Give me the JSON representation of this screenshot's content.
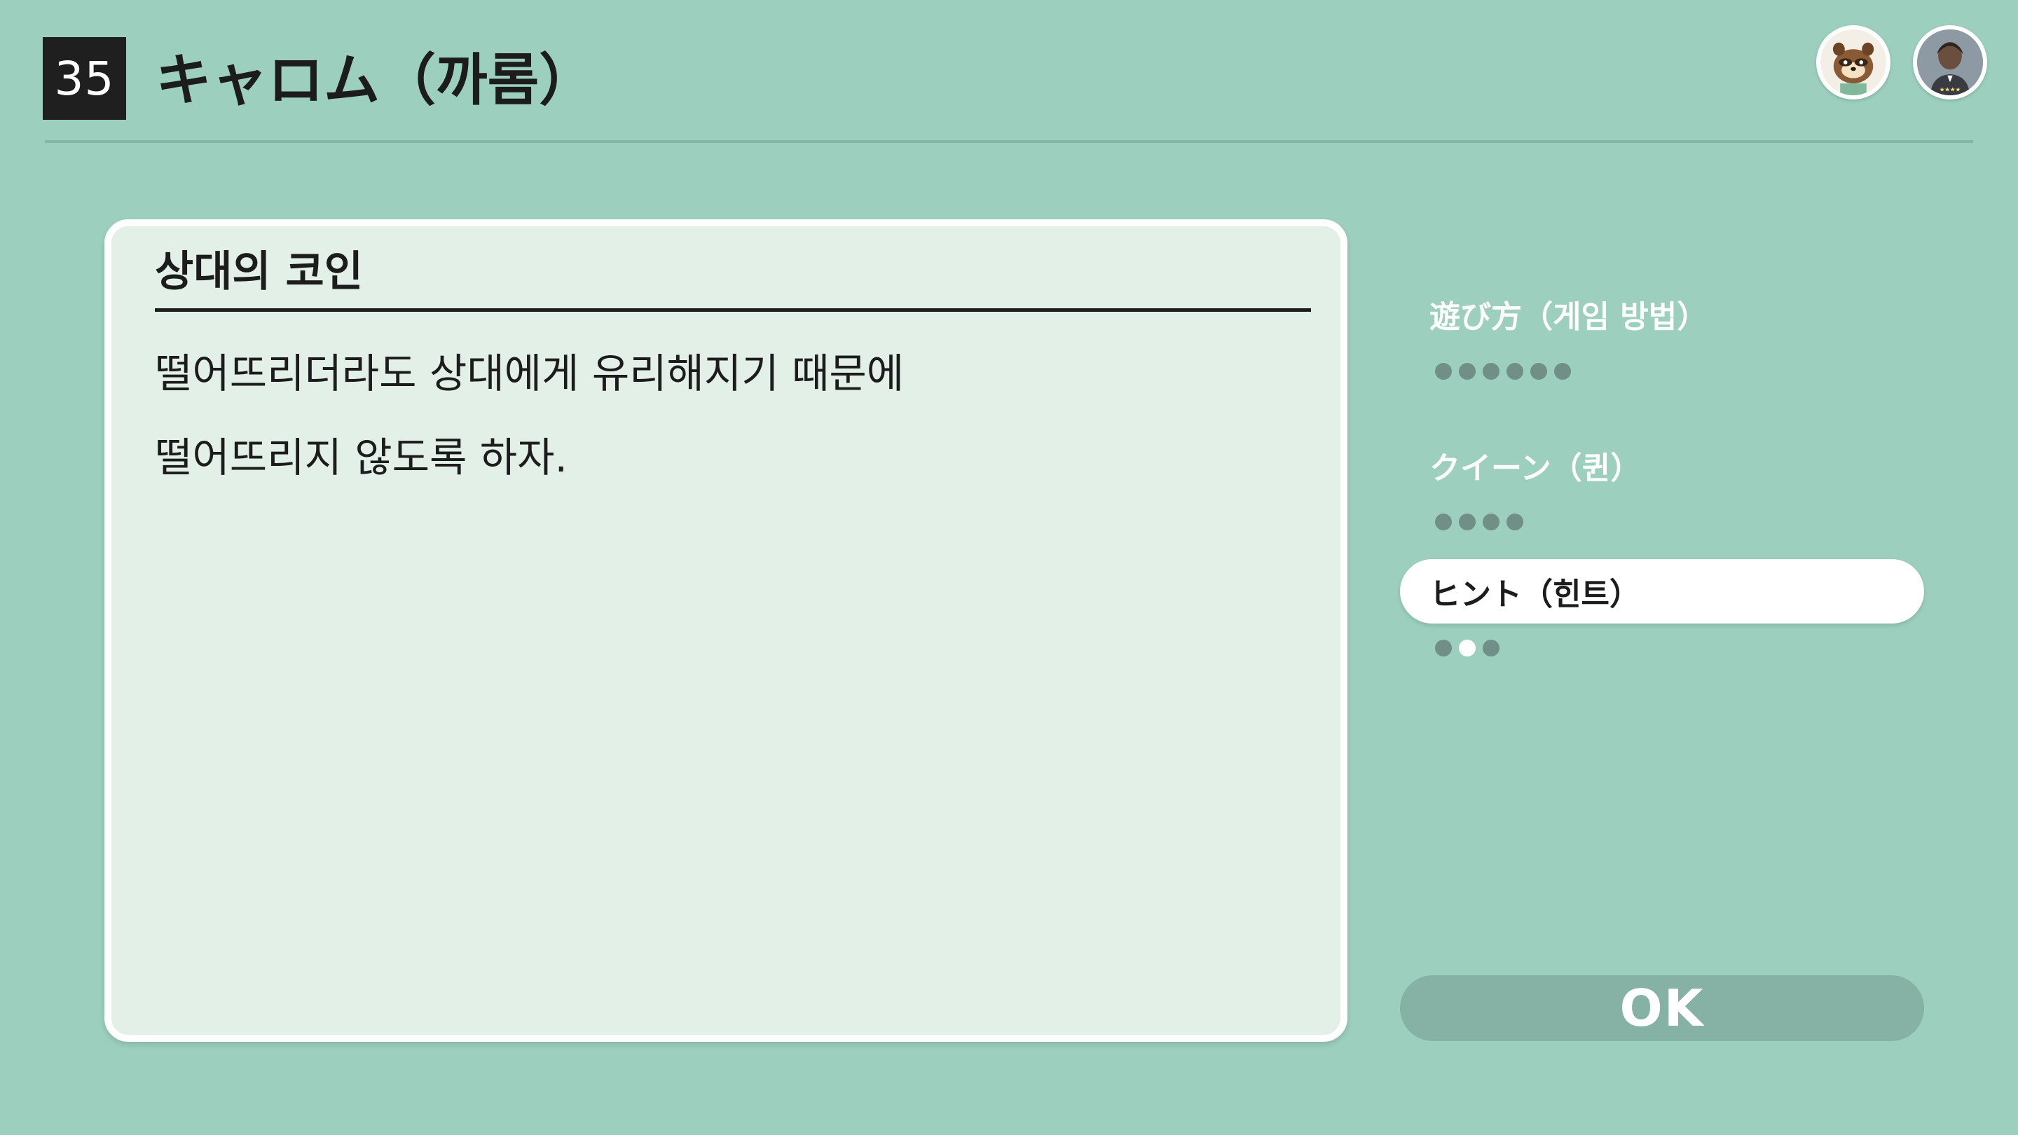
{
  "header": {
    "game_number": "35",
    "title": "キャロム（까롬）"
  },
  "avatars": [
    {
      "name": "tom-nook-avatar"
    },
    {
      "name": "player-avatar"
    }
  ],
  "panel": {
    "heading": "상대의 코인",
    "lines": [
      "떨어뜨리더라도 상대에게 유리해지기 때문에",
      "떨어뜨리지 않도록 하자."
    ]
  },
  "menu": {
    "items": [
      {
        "label": "遊び方（게임 방법）",
        "pages": 6,
        "current": 0,
        "active": false
      },
      {
        "label": "クイーン（퀸）",
        "pages": 4,
        "current": 0,
        "active": false
      },
      {
        "label": "ヒント（힌트）",
        "pages": 3,
        "current": 1,
        "active": true
      }
    ]
  },
  "ok_button": {
    "label": "OK"
  },
  "colors": {
    "background": "#9ccfbd",
    "panel": "#e3f0e8",
    "ok_button": "#86b1a5",
    "dot_inactive": "#6f8f87",
    "dot_active": "#ffffff"
  }
}
